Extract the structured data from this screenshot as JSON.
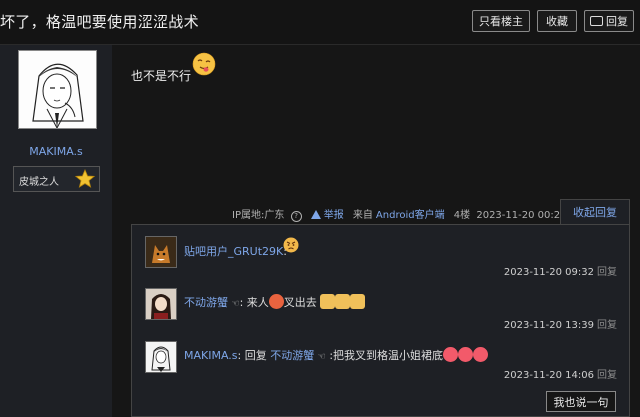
{
  "header": {
    "title": "坏了，格温吧要使用涩涩战术",
    "only_author": "只看楼主",
    "favorite": "收藏",
    "reply": "回复"
  },
  "author": {
    "name": "MAKIMA.s",
    "badge": "皮城之人"
  },
  "post": {
    "text": "也不是不行",
    "ip_label": "IP属地:广东",
    "report": "举报",
    "source_prefix": "来自",
    "source_app": "Android客户端",
    "floor": "4楼",
    "time": "2023-11-20 00:29",
    "fold": "收起回复"
  },
  "comments": [
    {
      "user": "贴吧用户_GRUt29K",
      "sep": ":",
      "text": "",
      "time": "2023-11-20 09:32",
      "reply": "回复"
    },
    {
      "user": "不动游蟹",
      "hand": "☜",
      "sep": ":",
      "text_a": "来人",
      "text_b": "叉出去",
      "time": "2023-11-20 13:39",
      "reply": "回复"
    },
    {
      "user": "MAKIMA.s",
      "sep": ":",
      "reply_word": "回复",
      "target": "不动游蟹",
      "hand": "☜",
      "text": ":把我叉到格温小姐裙底",
      "time": "2023-11-20 14:06",
      "reply": "回复"
    }
  ],
  "say_button": "我也说一句",
  "colors": {
    "link": "#7ea6e8",
    "bg": "#161616",
    "panel": "#1e2025"
  }
}
